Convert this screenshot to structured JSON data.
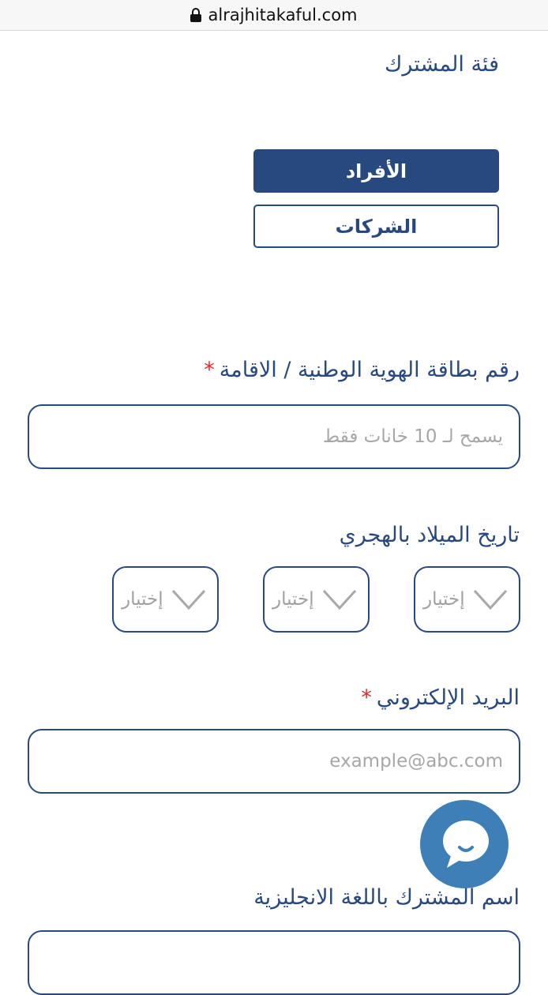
{
  "browser": {
    "url": "alrajhitakaful.com"
  },
  "subscriber": {
    "category_label": "فئة المشترك",
    "individuals_label": "الأفراد",
    "companies_label": "الشركات"
  },
  "national_id": {
    "label": "رقم بطاقة الهوية الوطنية / الاقامة",
    "required_mark": "*",
    "placeholder": "يسمح لـ 10 خانات فقط",
    "value": ""
  },
  "dob_hijri": {
    "label": "تاريخ الميلاد بالهجري",
    "selects": [
      {
        "value": "إختيار"
      },
      {
        "value": "إختيار"
      },
      {
        "value": "إختيار"
      }
    ]
  },
  "email": {
    "label": "البريد الإلكتروني",
    "required_mark": "*",
    "placeholder": "example@abc.com",
    "value": ""
  },
  "name_english": {
    "label": "اسم المشترك باللغة الانجليزية"
  },
  "colors": {
    "primary": "#27497f",
    "required": "#e02d2d",
    "chat": "#3f7fb8"
  }
}
